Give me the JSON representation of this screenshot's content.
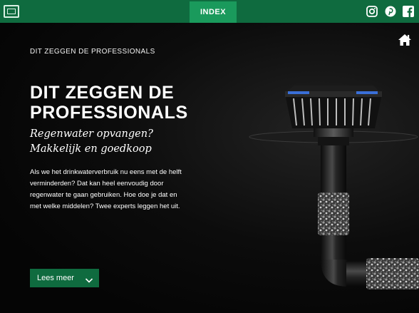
{
  "topbar": {
    "index_label": "INDEX",
    "brand_color": "#0f6b3f",
    "active_tab_color": "#1a9a5c",
    "social_icons": [
      "instagram-icon",
      "pinterest-icon",
      "facebook-icon"
    ]
  },
  "nav": {
    "home_icon": "home-icon"
  },
  "hero": {
    "breadcrumb": "DIT ZEGGEN DE PROFESSIONALS",
    "title_line1": "DIT ZEGGEN DE",
    "title_line2": "PROFESSIONALS",
    "subtitle_line1": "Regenwater opvangen?",
    "subtitle_line2": "Makkelijk en goedkoop",
    "body": "Als we het drinkwaterverbruik nu eens met de helft verminderden? Dat kan heel eenvoudig door regenwater te gaan gebruiken. Hoe doe je dat en met welke middelen? Twee experts leggen het uit.",
    "cta_label": "Lees meer",
    "cta_icon": "chevron-down-icon"
  },
  "illustration": {
    "name": "roof-drain-pipe-image",
    "accent_color": "#3a6fd8"
  }
}
